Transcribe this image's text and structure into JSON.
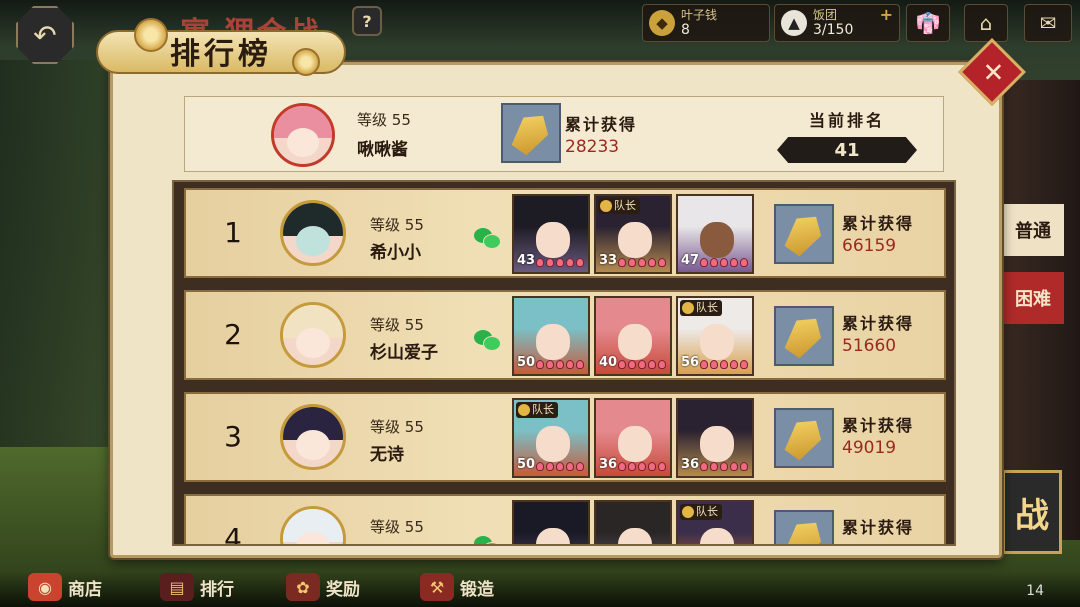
{
  "header": {
    "event_title": "寓·狸合战",
    "help_label": "?",
    "back_icon": "back-arrow-icon",
    "resources": [
      {
        "name": "叶子钱",
        "value": "8",
        "icon": "leaf-coin-icon"
      },
      {
        "name": "饭团",
        "value": "3/150",
        "icon": "rice-ball-icon",
        "plus": "+"
      }
    ],
    "icons": [
      "wardrobe-icon",
      "home-icon",
      "mail-icon"
    ]
  },
  "panel": {
    "title": "排行榜",
    "close_label": "✕"
  },
  "me": {
    "level_label": "等级",
    "level": "55",
    "name": "啾啾酱",
    "accumulated_label": "累计获得",
    "accumulated": "28233",
    "rank_label": "当前排名",
    "rank": "41"
  },
  "ranking": [
    {
      "rank": "1",
      "level_label": "等级",
      "level": "55",
      "name": "希小小",
      "accumulated_label": "累计获得",
      "accumulated": "66159",
      "team": [
        {
          "level": "43",
          "captain": false,
          "color": "purple"
        },
        {
          "level": "33",
          "captain": true,
          "captain_label": "队长",
          "color": "gold"
        },
        {
          "level": "47",
          "captain": false,
          "color": "purple"
        }
      ]
    },
    {
      "rank": "2",
      "level_label": "等级",
      "level": "55",
      "name": "杉山爱子",
      "accumulated_label": "累计获得",
      "accumulated": "51660",
      "team": [
        {
          "level": "50",
          "captain": false,
          "color": "red"
        },
        {
          "level": "40",
          "captain": false,
          "color": "red"
        },
        {
          "level": "56",
          "captain": true,
          "captain_label": "队长",
          "color": "gold"
        }
      ]
    },
    {
      "rank": "3",
      "level_label": "等级",
      "level": "55",
      "name": "无诗",
      "accumulated_label": "累计获得",
      "accumulated": "49019",
      "team": [
        {
          "level": "50",
          "captain": true,
          "captain_label": "队长",
          "color": "red"
        },
        {
          "level": "36",
          "captain": false,
          "color": "red"
        },
        {
          "level": "36",
          "captain": false,
          "color": "gold"
        }
      ]
    },
    {
      "rank": "4",
      "level_label": "等级",
      "level": "55",
      "name": "",
      "accumulated_label": "累计获得",
      "accumulated": "",
      "team": [
        {
          "level": "",
          "captain": false,
          "color": "purple"
        },
        {
          "level": "",
          "captain": false,
          "color": "purple"
        },
        {
          "level": "",
          "captain": true,
          "captain_label": "队长",
          "color": "red"
        }
      ]
    }
  ],
  "side_tabs": [
    "普通",
    "困难"
  ],
  "side_banner": "战",
  "bottom_nav": [
    {
      "label": "商店",
      "icon": "shop-icon"
    },
    {
      "label": "排行",
      "icon": "ranking-icon"
    },
    {
      "label": "奖励",
      "icon": "reward-icon"
    },
    {
      "label": "锻造",
      "icon": "forge-icon"
    }
  ],
  "bottom_count": "14",
  "colors": {
    "panel_bg": "#efe4c6",
    "accent_red": "#b4232a",
    "value_red": "#9b2a1e",
    "chat_green": "#29b14a"
  }
}
